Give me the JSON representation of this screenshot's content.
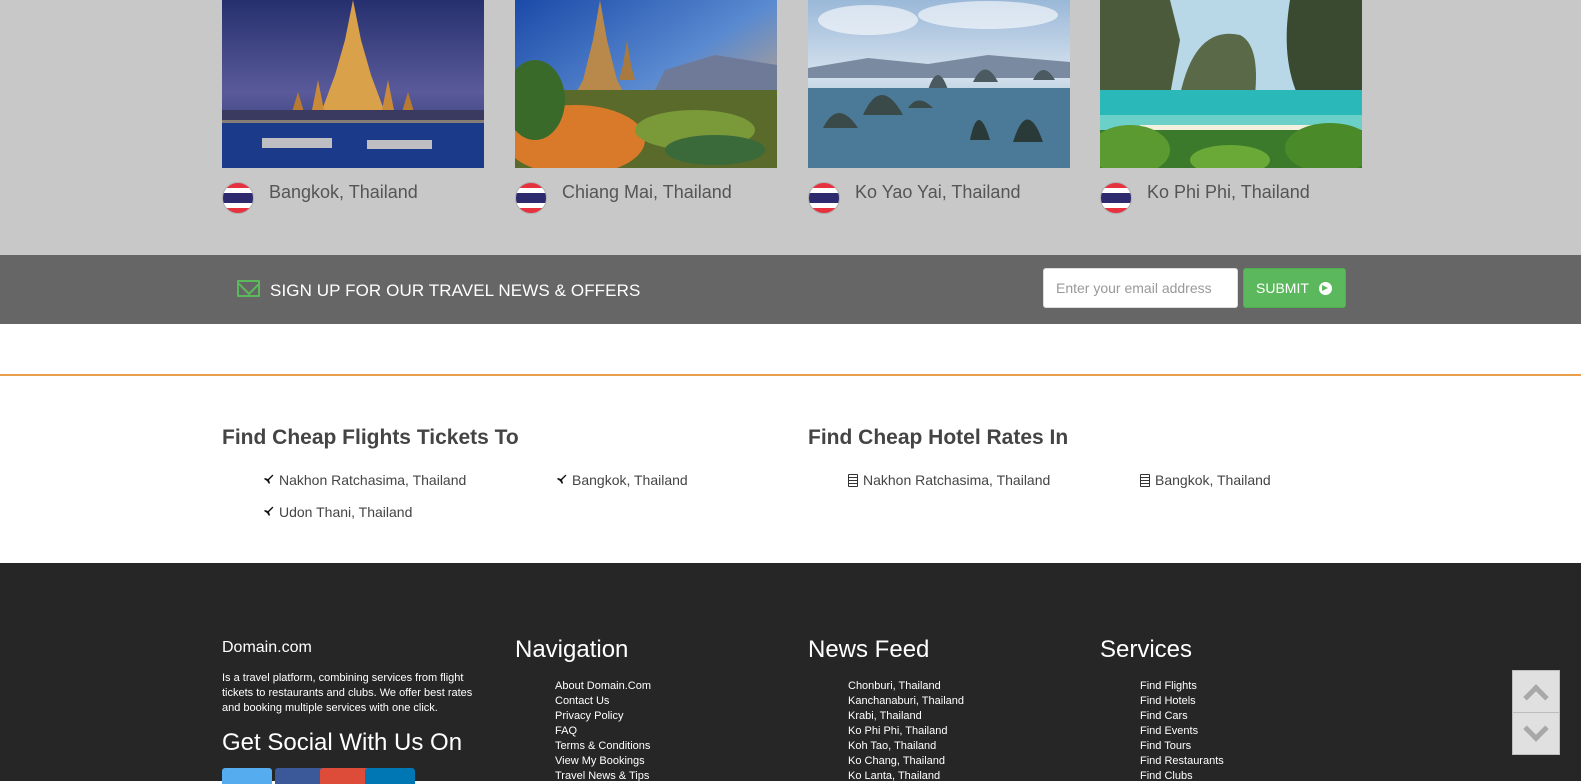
{
  "destinations": [
    {
      "name": "Bangkok, Thailand",
      "photo_icon": "temple-night-photo"
    },
    {
      "name": "Chiang Mai, Thailand",
      "photo_icon": "pagoda-sunset-photo"
    },
    {
      "name": "Ko Yao Yai, Thailand",
      "photo_icon": "islands-bay-photo"
    },
    {
      "name": "Ko Phi Phi, Thailand",
      "photo_icon": "beach-cliffs-photo"
    }
  ],
  "newsletter": {
    "title": "SIGN UP FOR OUR TRAVEL NEWS & OFFERS",
    "email_placeholder": "Enter your email address",
    "email_value": "",
    "submit_label": "SUBMIT"
  },
  "flights": {
    "title": "Find Cheap Flights Tickets To",
    "links": [
      "Nakhon Ratchasima, Thailand",
      "Bangkok, Thailand",
      "Udon Thani, Thailand"
    ]
  },
  "hotels": {
    "title": "Find Cheap Hotel Rates In",
    "links": [
      "Nakhon Ratchasima, Thailand",
      "Bangkok, Thailand"
    ]
  },
  "footer": {
    "brand": "Domain.com",
    "about": "Is a travel platform, combining services from flight tickets to restaurants and clubs. We offer best rates and booking multiple services with one click.",
    "social_title": "Get Social With Us On",
    "navigation": {
      "title": "Navigation",
      "items": [
        "About Domain.Com",
        "Contact Us",
        "Privacy Policy",
        "FAQ",
        "Terms & Conditions",
        "View My Bookings",
        "Travel News & Tips"
      ]
    },
    "news": {
      "title": "News Feed",
      "items": [
        "Chonburi, Thailand",
        "Kanchanaburi, Thailand",
        "Krabi, Thailand",
        "Ko Phi Phi, Thailand",
        "Koh Tao, Thailand",
        "Ko Chang, Thailand",
        "Ko Lanta, Thailand"
      ]
    },
    "services": {
      "title": "Services",
      "items": [
        "Find Flights",
        "Find Hotels",
        "Find Cars",
        "Find Events",
        "Find Tours",
        "Find Restaurants",
        "Find Clubs"
      ]
    }
  },
  "colors": {
    "accent_green": "#5cb85c",
    "divider_orange": "#e8a04a",
    "footer_bg": "#262626",
    "signup_bg": "#666666"
  }
}
